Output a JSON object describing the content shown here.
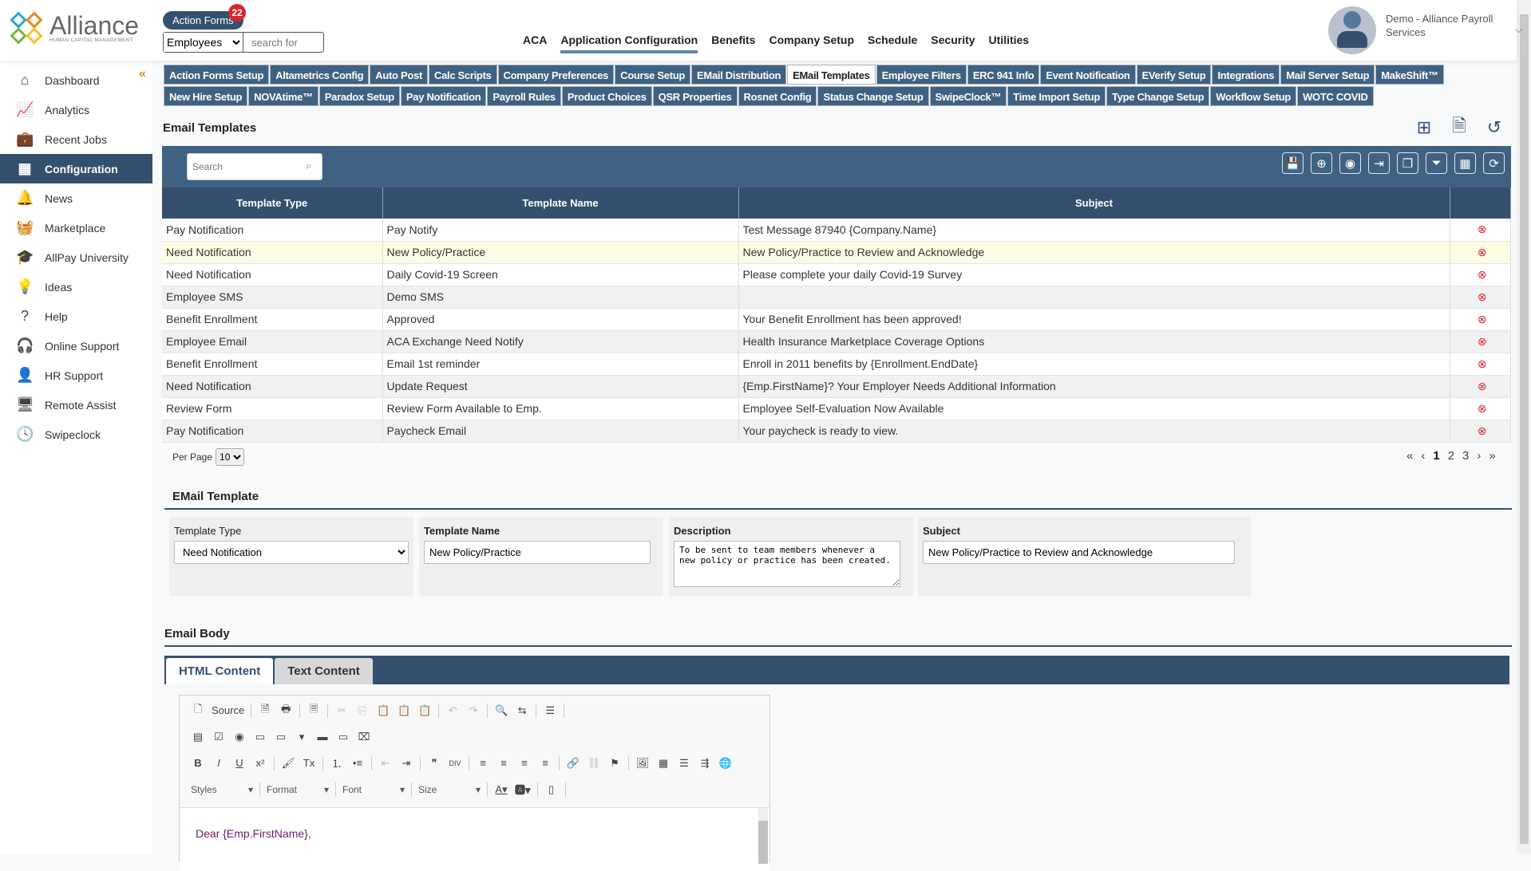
{
  "header": {
    "logo": "Alliance",
    "logo_sub": "HUMAN CAPITAL MANAGEMENT",
    "action_forms": "Action Forms",
    "action_forms_count": "22",
    "search_scope": "Employees",
    "search_placeholder": "search for",
    "nav": [
      "ACA",
      "Application Configuration",
      "Benefits",
      "Company Setup",
      "Schedule",
      "Security",
      "Utilities"
    ],
    "nav_active": "Application Configuration",
    "user": "Demo - Alliance Payroll Services"
  },
  "sidebar": {
    "items": [
      {
        "label": "Dashboard",
        "icon": "⌂"
      },
      {
        "label": "Analytics",
        "icon": "📈"
      },
      {
        "label": "Recent Jobs",
        "icon": "💼"
      },
      {
        "label": "Configuration",
        "icon": "▦"
      },
      {
        "label": "News",
        "icon": "🔔"
      },
      {
        "label": "Marketplace",
        "icon": "🧺"
      },
      {
        "label": "AllPay University",
        "icon": "🎓"
      },
      {
        "label": "Ideas",
        "icon": "💡"
      },
      {
        "label": "Help",
        "icon": "?"
      },
      {
        "label": "Online Support",
        "icon": "🎧"
      },
      {
        "label": "HR Support",
        "icon": "👤"
      },
      {
        "label": "Remote Assist",
        "icon": "🖥"
      },
      {
        "label": "Swipeclock",
        "icon": "🕓"
      }
    ],
    "active": "Configuration"
  },
  "tabs": [
    "Action Forms Setup",
    "Altametrics Config",
    "Auto Post",
    "Calc Scripts",
    "Company Preferences",
    "Course Setup",
    "EMail Distribution",
    "EMail Templates",
    "Employee Filters",
    "ERC 941 Info",
    "Event Notification",
    "EVerify Setup",
    "Integrations",
    "Mail Server Setup",
    "MakeShift™",
    "New Hire Setup",
    "NOVAtime™",
    "Paradox Setup",
    "Pay Notification",
    "Payroll Rules",
    "Product Choices",
    "QSR Properties",
    "Rosnet Config",
    "Status Change Setup",
    "SwipeClock™",
    "Time Import Setup",
    "Type Change Setup",
    "Workflow Setup",
    "WOTC COVID"
  ],
  "active_tab": "EMail Templates",
  "page_title": "Email Templates",
  "grid": {
    "search_placeholder": "Search",
    "columns": [
      "Template Type",
      "Template Name",
      "Subject"
    ],
    "rows": [
      [
        "Pay Notification",
        "Pay Notify",
        "Test Message 87940 {Company.Name}"
      ],
      [
        "Need Notification",
        "New Policy/Practice",
        "New Policy/Practice to Review and Acknowledge"
      ],
      [
        "Need Notification",
        "Daily Covid-19 Screen",
        "Please complete your daily Covid-19 Survey"
      ],
      [
        "Employee SMS",
        "Demo SMS",
        ""
      ],
      [
        "Benefit Enrollment",
        "Approved",
        "Your Benefit Enrollment has been approved!"
      ],
      [
        "Employee Email",
        "ACA Exchange Need Notify",
        "Health Insurance Marketplace Coverage Options"
      ],
      [
        "Benefit Enrollment",
        "Email 1st reminder",
        "Enroll in 2011 benefits by {Enrollment.EndDate}"
      ],
      [
        "Need Notification",
        "Update Request",
        "{Emp.FirstName}? Your Employer Needs Additional Information"
      ],
      [
        "Review Form",
        "Review Form Available to Emp.",
        "Employee Self-Evaluation Now Available"
      ],
      [
        "Pay Notification",
        "Paycheck Email",
        "Your paycheck is ready to view."
      ]
    ],
    "selected_row": 1,
    "per_page_label": "Per Page",
    "per_page": "10",
    "pages": [
      "1",
      "2",
      "3"
    ],
    "current_page": "1"
  },
  "form": {
    "title": "EMail Template",
    "template_type_label": "Template Type",
    "template_type": "Need Notification",
    "template_name_label": "Template Name",
    "template_name": "New Policy/Practice",
    "description_label": "Description",
    "description": "To be sent to team members whenever a new policy or practice has been created.",
    "subject_label": "Subject",
    "subject": "New Policy/Practice to Review and Acknowledge"
  },
  "body": {
    "title": "Email Body",
    "tabs": [
      "HTML Content",
      "Text Content"
    ],
    "source": "Source",
    "styles": "Styles",
    "format": "Format",
    "font": "Font",
    "size": "Size",
    "content": "Dear {Emp.FirstName},"
  },
  "colors": {
    "primary": "#35506e",
    "tab": "#3f6283",
    "accent": "#e28a1b",
    "danger": "#d9262c"
  }
}
